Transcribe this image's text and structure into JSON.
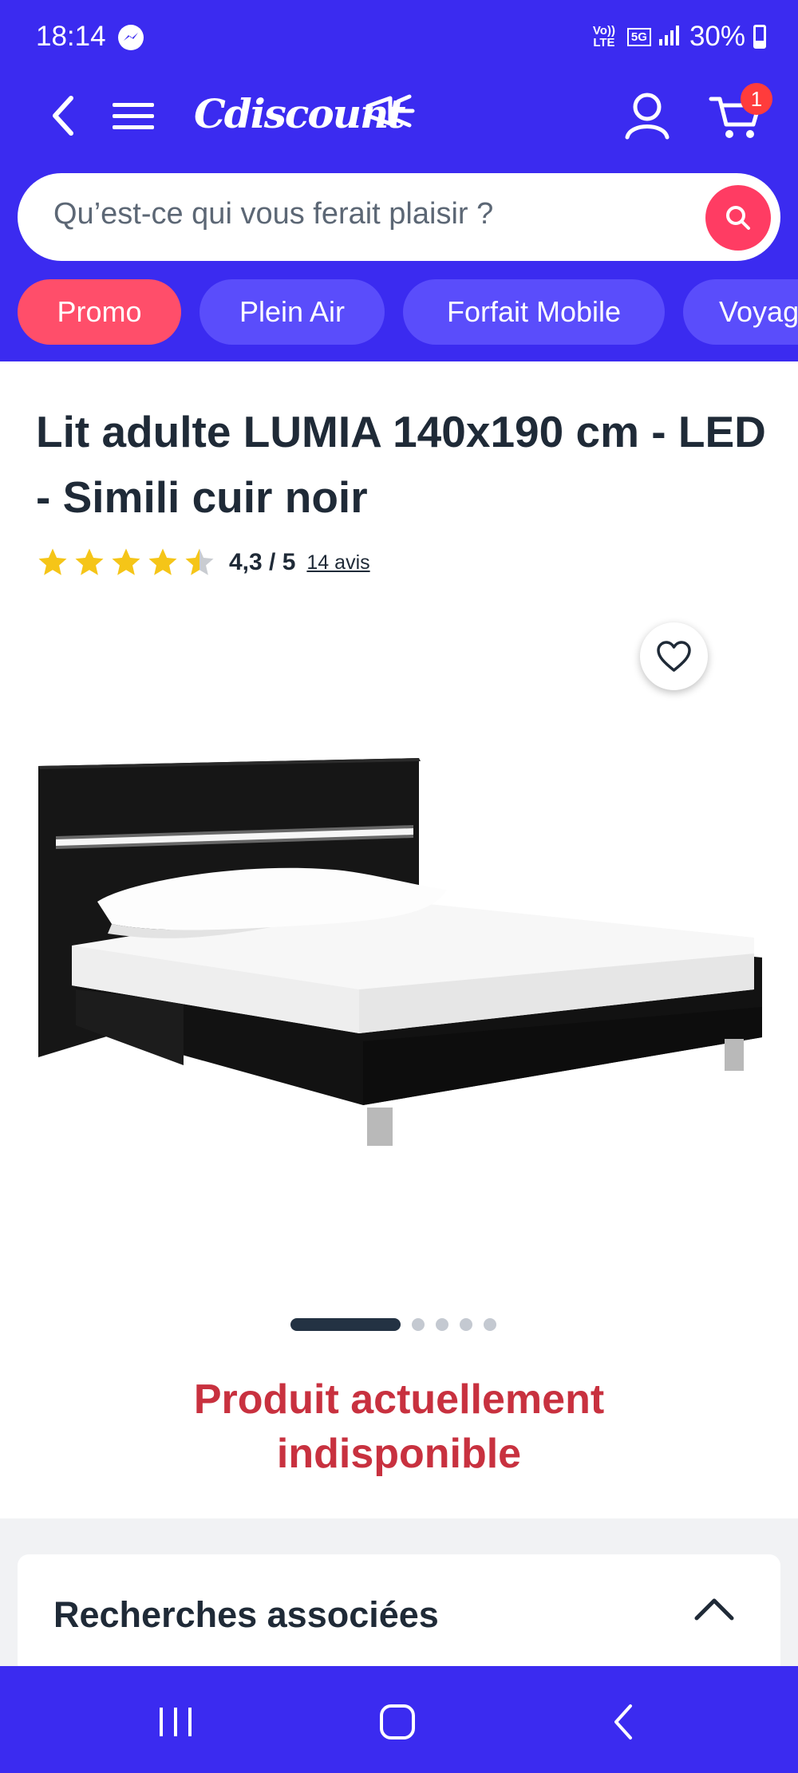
{
  "status_bar": {
    "time": "18:14",
    "network_volte": "Vo)) LTE",
    "network_5g": "5G",
    "battery": "30%"
  },
  "header": {
    "logo": "Cdiscount",
    "cart_count": "1"
  },
  "search": {
    "placeholder": "Qu’est-ce qui vous ferait plaisir ?"
  },
  "chips": [
    "Promo",
    "Plein Air",
    "Forfait Mobile",
    "Voyag"
  ],
  "product": {
    "title": "Lit adulte LUMIA 140x190 cm - LED - Simili cuir noir",
    "rating_value": 4.3,
    "rating_text": "4,3 / 5",
    "reviews": "14 avis",
    "image_count": 5,
    "active_image": 1,
    "availability_line1": "Produit actuellement",
    "availability_line2": "indisponible"
  },
  "related": {
    "title": "Recherches associées"
  },
  "colors": {
    "brand_blue": "#3b2bf0",
    "accent_pink": "#ff3c63",
    "unavailable_red": "#c8313f",
    "star_yellow": "#f5c518"
  }
}
